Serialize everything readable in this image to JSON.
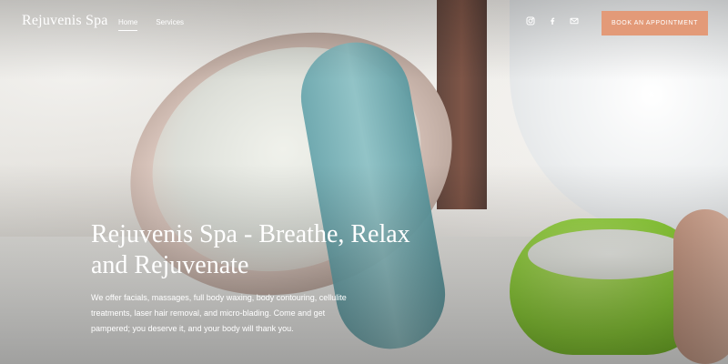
{
  "brand": {
    "name": "Rejuvenis Spa"
  },
  "nav": {
    "items": [
      {
        "label": "Home",
        "active": true
      },
      {
        "label": "Services",
        "active": false
      }
    ]
  },
  "social": {
    "icons": [
      "instagram-icon",
      "facebook-icon",
      "email-icon"
    ]
  },
  "cta": {
    "label": "BOOK AN APPOINTMENT",
    "color": "#e39a78"
  },
  "hero": {
    "title": "Rejuvenis Spa - Breathe, Relax and Rejuvenate",
    "description": "We offer facials, massages, full body waxing, body contouring, cellulite treatments, laser hair removal, and micro-blading. Come and get pampered; you deserve it, and your body will thank you."
  }
}
